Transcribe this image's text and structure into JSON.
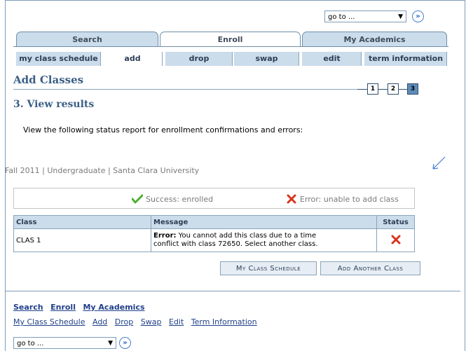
{
  "goto": {
    "label": "go to ...",
    "arrow": "▼",
    "go": "»"
  },
  "tabs": [
    {
      "label": "Search"
    },
    {
      "label": "Enroll"
    },
    {
      "label": "My Academics"
    }
  ],
  "sub_tabs": [
    {
      "label": "my class schedule"
    },
    {
      "label": "add"
    },
    {
      "label": "drop"
    },
    {
      "label": "swap"
    },
    {
      "label": "edit"
    },
    {
      "label": "term information"
    }
  ],
  "page_title": "Add Classes",
  "steps": [
    "1",
    "2",
    "3"
  ],
  "step_heading": "3.  View results",
  "intro": "View the following status report for enrollment confirmations and errors:",
  "term": "Fall 2011 | Undergraduate | Santa Clara University",
  "legend": {
    "success": "Success: enrolled",
    "error": "Error: unable to add class"
  },
  "table": {
    "headers": {
      "class": "Class",
      "message": "Message",
      "status": "Status"
    },
    "rows": [
      {
        "class": "CLAS  1",
        "message_bold": "Error:",
        "message_line1": " You cannot add this class due to a time",
        "message_line2": "conflict with class 72650. Select another class."
      }
    ]
  },
  "buttons": {
    "schedule": "My Class Schedule",
    "add_another": "Add Another Class"
  },
  "bottom_nav": {
    "row1": [
      "Search",
      "Enroll",
      "My Academics"
    ],
    "row2": [
      "My Class Schedule",
      "Add",
      "Drop",
      "Swap",
      "Edit",
      "Term Information"
    ]
  },
  "colors": {
    "tab_bg": "#cbdceb",
    "title": "#3a5f86",
    "success": "#4caf2f",
    "error": "#d8341e",
    "link": "#1f3f8a"
  }
}
